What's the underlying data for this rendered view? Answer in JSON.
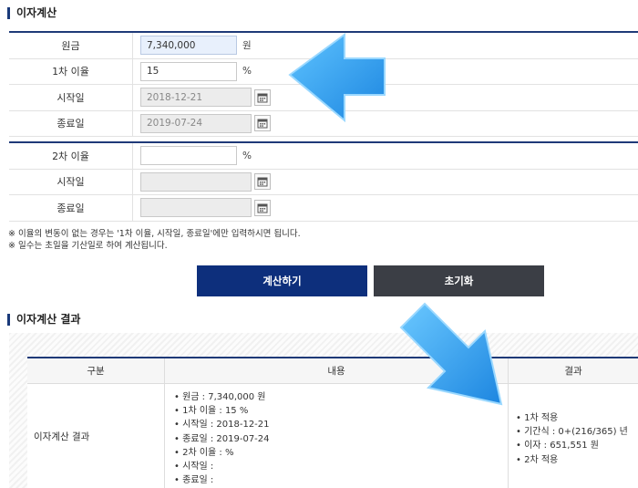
{
  "sections": {
    "calc_title": "이자계산",
    "result_title": "이자계산 결과"
  },
  "form1": {
    "principal_label": "원금",
    "principal_value": "7,340,000",
    "principal_unit": "원",
    "rate1_label": "1차 이율",
    "rate1_value": "15",
    "rate_unit": "%",
    "start_label": "시작일",
    "start_value": "2018-12-21",
    "end_label": "종료일",
    "end_value": "2019-07-24"
  },
  "form2": {
    "rate2_label": "2차 이율",
    "rate2_value": "",
    "rate_unit": "%",
    "start_label": "시작일",
    "start_value": "",
    "end_label": "종료일",
    "end_value": ""
  },
  "notes": [
    "※ 이율의 변동이 없는 경우는 '1차 이율, 시작일, 종료일'에만 입력하시면 됩니다.",
    "※ 일수는 초일을 기산일로 하여 계산됩니다."
  ],
  "buttons": {
    "calc": "계산하기",
    "reset": "초기화"
  },
  "result": {
    "headers": [
      "구분",
      "내용",
      "결과"
    ],
    "row_label": "이자계산 결과",
    "content": [
      "• 원금 : 7,340,000 원",
      "• 1차 이율 : 15 %",
      "• 시작일 : 2018-12-21",
      "• 종료일 : 2019-07-24",
      "• 2차 이율 : %",
      "• 시작일 :",
      "• 종료일 :"
    ],
    "outcome": [
      "• 1차 적용",
      "• 기간식 : 0+(216/365) 년",
      "• 이자 : 651,551 원",
      "• 2차 적용"
    ]
  },
  "colors": {
    "navy": "#0d2f7c",
    "dark_button": "#3b3e45",
    "arrow": "#3aa4ee"
  },
  "icons": [
    "calendar-icon",
    "arrow-left-icon",
    "arrow-down-right-icon"
  ]
}
